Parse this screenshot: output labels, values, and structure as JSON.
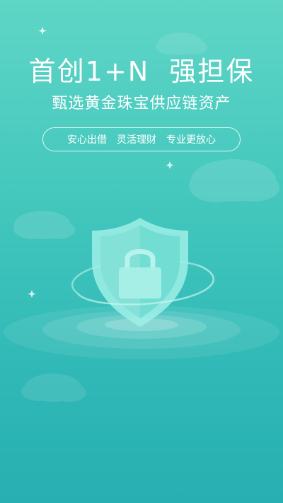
{
  "colors": {
    "background_top": "#5fd6c6",
    "background_bottom": "#27afb1",
    "text": "#ffffff",
    "shield": "#8fe8e0"
  },
  "headline": {
    "part1": "首创1+N",
    "part2": "强担保"
  },
  "subtitle": "甄选黄金珠宝供应链资产",
  "features": [
    "安心出借",
    "灵活理财",
    "专业更放心"
  ],
  "icons": {
    "hero": "shield-lock-icon",
    "decor": [
      "cloud-icon",
      "sparkle-icon"
    ]
  }
}
